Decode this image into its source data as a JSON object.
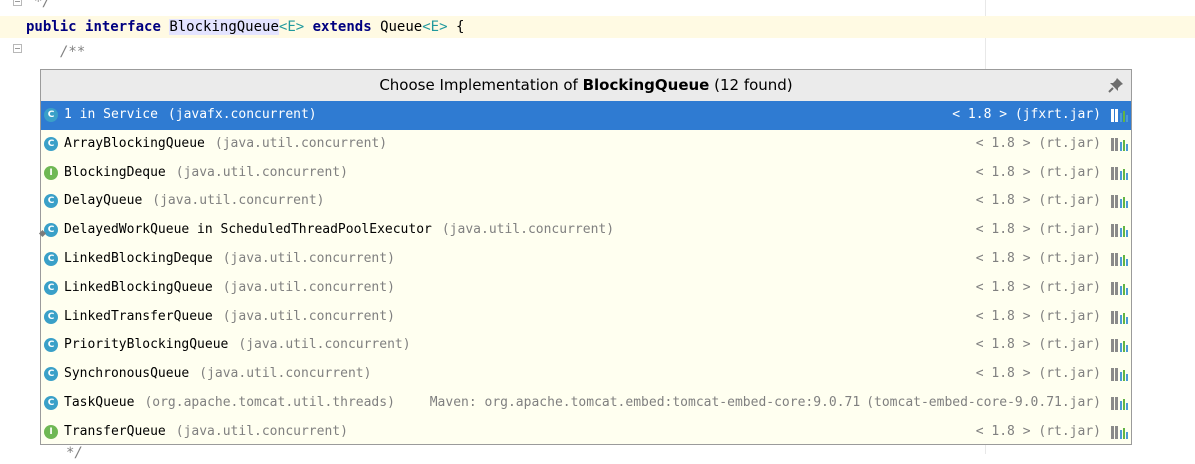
{
  "editor": {
    "line1_comment": "*/",
    "kw_public": "public",
    "kw_interface": "interface",
    "interface_name": "BlockingQueue",
    "type_param": "<E>",
    "kw_extends": "extends",
    "super_name": "Queue",
    "super_type_param": "<E>",
    "brace": "{",
    "doc_start": "/**",
    "bottom_comment": "*/"
  },
  "popup": {
    "title_prefix": "Choose Implementation of ",
    "title_name": "BlockingQueue",
    "title_suffix": " (12 found)",
    "pin_icon": "pin-icon",
    "items": [
      {
        "name": "1 in Service",
        "pkg": "(javafx.concurrent)",
        "ver": "< 1.8 >",
        "jar": "(jfxrt.jar)",
        "kind": "class",
        "inner": false,
        "selected": true
      },
      {
        "name": "ArrayBlockingQueue",
        "pkg": "(java.util.concurrent)",
        "ver": "< 1.8 >",
        "jar": "(rt.jar)",
        "kind": "class",
        "inner": false
      },
      {
        "name": "BlockingDeque",
        "pkg": "(java.util.concurrent)",
        "ver": "< 1.8 >",
        "jar": "(rt.jar)",
        "kind": "interface",
        "inner": false
      },
      {
        "name": "DelayQueue",
        "pkg": "(java.util.concurrent)",
        "ver": "< 1.8 >",
        "jar": "(rt.jar)",
        "kind": "class",
        "inner": false
      },
      {
        "name": "DelayedWorkQueue in ScheduledThreadPoolExecutor",
        "pkg": "(java.util.concurrent)",
        "ver": "< 1.8 >",
        "jar": "(rt.jar)",
        "kind": "class",
        "inner": true
      },
      {
        "name": "LinkedBlockingDeque",
        "pkg": "(java.util.concurrent)",
        "ver": "< 1.8 >",
        "jar": "(rt.jar)",
        "kind": "class",
        "inner": false
      },
      {
        "name": "LinkedBlockingQueue",
        "pkg": "(java.util.concurrent)",
        "ver": "< 1.8 >",
        "jar": "(rt.jar)",
        "kind": "class",
        "inner": false
      },
      {
        "name": "LinkedTransferQueue",
        "pkg": "(java.util.concurrent)",
        "ver": "< 1.8 >",
        "jar": "(rt.jar)",
        "kind": "class",
        "inner": false
      },
      {
        "name": "PriorityBlockingQueue",
        "pkg": "(java.util.concurrent)",
        "ver": "< 1.8 >",
        "jar": "(rt.jar)",
        "kind": "class",
        "inner": false
      },
      {
        "name": "SynchronousQueue",
        "pkg": "(java.util.concurrent)",
        "ver": "< 1.8 >",
        "jar": "(rt.jar)",
        "kind": "class",
        "inner": false
      },
      {
        "name": "TaskQueue",
        "pkg": "(org.apache.tomcat.util.threads)",
        "maven": "Maven: org.apache.tomcat.embed:tomcat-embed-core:9.0.71",
        "ver": "",
        "jar": "(tomcat-embed-core-9.0.71.jar)",
        "kind": "class",
        "inner": false
      },
      {
        "name": "TransferQueue",
        "pkg": "(java.util.concurrent)",
        "ver": "< 1.8 >",
        "jar": "(rt.jar)",
        "kind": "interface",
        "inner": false
      }
    ]
  },
  "colors": {
    "selection": "#2f7bd2",
    "popup_bg": "#fffff0",
    "keyword": "#000080",
    "type_param": "#20999d"
  }
}
